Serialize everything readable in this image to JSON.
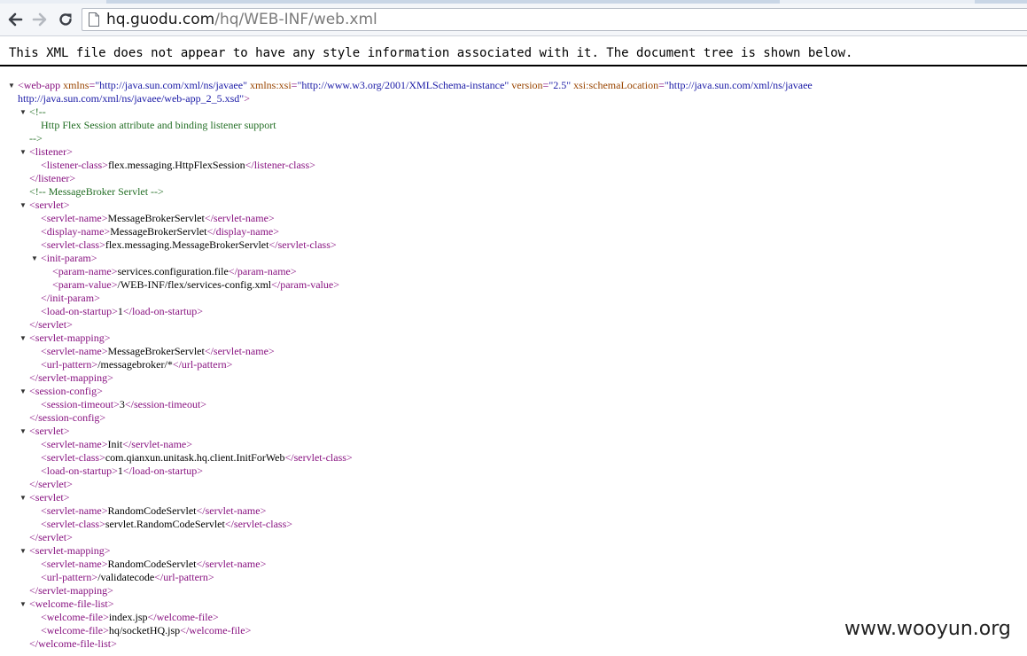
{
  "browser": {
    "url_host": "hq.guodu.com",
    "url_path": "/hq/WEB-INF/web.xml",
    "back_icon": "arrow-left-icon",
    "forward_icon": "arrow-right-icon",
    "reload_icon": "reload-icon",
    "page_icon": "page-icon"
  },
  "xml_viewer": {
    "header": "This XML file does not appear to have any style information associated with it. The document tree is shown below.",
    "colors": {
      "tag": "#881280",
      "attribute": "#994500",
      "value": "#1a1aa6",
      "comment": "#236e25"
    },
    "lines": [
      {
        "fold": true,
        "indent": 0,
        "parts": [
          [
            "tag",
            "<web-app "
          ],
          [
            "attr",
            "xmlns"
          ],
          [
            "tag",
            "="
          ],
          [
            "val",
            "\"http://java.sun.com/xml/ns/javaee\""
          ],
          [
            "tag",
            " "
          ],
          [
            "attr",
            "xmlns:xsi"
          ],
          [
            "tag",
            "="
          ],
          [
            "val",
            "\"http://www.w3.org/2001/XMLSchema-instance\""
          ],
          [
            "tag",
            " "
          ],
          [
            "attr",
            "version"
          ],
          [
            "tag",
            "="
          ],
          [
            "val",
            "\"2.5\""
          ],
          [
            "tag",
            " "
          ],
          [
            "attr",
            "xsi:schemaLocation"
          ],
          [
            "tag",
            "="
          ],
          [
            "val",
            "\"http://java.sun.com/xml/ns/javaee"
          ]
        ]
      },
      {
        "fold": false,
        "indent": 0,
        "parts": [
          [
            "val",
            "http://java.sun.com/xml/ns/javaee/web-app_2_5.xsd\""
          ],
          [
            "tag",
            ">"
          ]
        ]
      },
      {
        "fold": true,
        "indent": 1,
        "parts": [
          [
            "cmt",
            "<!--"
          ]
        ]
      },
      {
        "fold": false,
        "indent": 2,
        "parts": [
          [
            "cmt",
            "  Http Flex Session attribute and binding listener support"
          ]
        ]
      },
      {
        "fold": false,
        "indent": 1,
        "parts": [
          [
            "cmt",
            "-->"
          ]
        ]
      },
      {
        "fold": true,
        "indent": 1,
        "parts": [
          [
            "tag",
            "<listener>"
          ]
        ]
      },
      {
        "fold": false,
        "indent": 2,
        "parts": [
          [
            "tag",
            "<listener-class>"
          ],
          [
            "txt",
            "flex.messaging.HttpFlexSession"
          ],
          [
            "tag",
            "</listener-class>"
          ]
        ]
      },
      {
        "fold": false,
        "indent": 1,
        "parts": [
          [
            "tag",
            "</listener>"
          ]
        ]
      },
      {
        "fold": false,
        "indent": 1,
        "parts": [
          [
            "cmt",
            "<!--  MessageBroker Servlet  -->"
          ]
        ]
      },
      {
        "fold": true,
        "indent": 1,
        "parts": [
          [
            "tag",
            "<servlet>"
          ]
        ]
      },
      {
        "fold": false,
        "indent": 2,
        "parts": [
          [
            "tag",
            "<servlet-name>"
          ],
          [
            "txt",
            "MessageBrokerServlet"
          ],
          [
            "tag",
            "</servlet-name>"
          ]
        ]
      },
      {
        "fold": false,
        "indent": 2,
        "parts": [
          [
            "tag",
            "<display-name>"
          ],
          [
            "txt",
            "MessageBrokerServlet"
          ],
          [
            "tag",
            "</display-name>"
          ]
        ]
      },
      {
        "fold": false,
        "indent": 2,
        "parts": [
          [
            "tag",
            "<servlet-class>"
          ],
          [
            "txt",
            "flex.messaging.MessageBrokerServlet"
          ],
          [
            "tag",
            "</servlet-class>"
          ]
        ]
      },
      {
        "fold": true,
        "indent": 2,
        "parts": [
          [
            "tag",
            "<init-param>"
          ]
        ]
      },
      {
        "fold": false,
        "indent": 3,
        "parts": [
          [
            "tag",
            "<param-name>"
          ],
          [
            "txt",
            "services.configuration.file"
          ],
          [
            "tag",
            "</param-name>"
          ]
        ]
      },
      {
        "fold": false,
        "indent": 3,
        "parts": [
          [
            "tag",
            "<param-value>"
          ],
          [
            "txt",
            "/WEB-INF/flex/services-config.xml"
          ],
          [
            "tag",
            "</param-value>"
          ]
        ]
      },
      {
        "fold": false,
        "indent": 2,
        "parts": [
          [
            "tag",
            "</init-param>"
          ]
        ]
      },
      {
        "fold": false,
        "indent": 2,
        "parts": [
          [
            "tag",
            "<load-on-startup>"
          ],
          [
            "txt",
            "1"
          ],
          [
            "tag",
            "</load-on-startup>"
          ]
        ]
      },
      {
        "fold": false,
        "indent": 1,
        "parts": [
          [
            "tag",
            "</servlet>"
          ]
        ]
      },
      {
        "fold": true,
        "indent": 1,
        "parts": [
          [
            "tag",
            "<servlet-mapping>"
          ]
        ]
      },
      {
        "fold": false,
        "indent": 2,
        "parts": [
          [
            "tag",
            "<servlet-name>"
          ],
          [
            "txt",
            "MessageBrokerServlet"
          ],
          [
            "tag",
            "</servlet-name>"
          ]
        ]
      },
      {
        "fold": false,
        "indent": 2,
        "parts": [
          [
            "tag",
            "<url-pattern>"
          ],
          [
            "txt",
            "/messagebroker/*"
          ],
          [
            "tag",
            "</url-pattern>"
          ]
        ]
      },
      {
        "fold": false,
        "indent": 1,
        "parts": [
          [
            "tag",
            "</servlet-mapping>"
          ]
        ]
      },
      {
        "fold": true,
        "indent": 1,
        "parts": [
          [
            "tag",
            "<session-config>"
          ]
        ]
      },
      {
        "fold": false,
        "indent": 2,
        "parts": [
          [
            "tag",
            "<session-timeout>"
          ],
          [
            "txt",
            "3"
          ],
          [
            "tag",
            "</session-timeout>"
          ]
        ]
      },
      {
        "fold": false,
        "indent": 1,
        "parts": [
          [
            "tag",
            "</session-config>"
          ]
        ]
      },
      {
        "fold": true,
        "indent": 1,
        "parts": [
          [
            "tag",
            "<servlet>"
          ]
        ]
      },
      {
        "fold": false,
        "indent": 2,
        "parts": [
          [
            "tag",
            "<servlet-name>"
          ],
          [
            "txt",
            "Init"
          ],
          [
            "tag",
            "</servlet-name>"
          ]
        ]
      },
      {
        "fold": false,
        "indent": 2,
        "parts": [
          [
            "tag",
            "<servlet-class>"
          ],
          [
            "txt",
            "com.qianxun.unitask.hq.client.InitForWeb"
          ],
          [
            "tag",
            "</servlet-class>"
          ]
        ]
      },
      {
        "fold": false,
        "indent": 2,
        "parts": [
          [
            "tag",
            "<load-on-startup>"
          ],
          [
            "txt",
            "1"
          ],
          [
            "tag",
            "</load-on-startup>"
          ]
        ]
      },
      {
        "fold": false,
        "indent": 1,
        "parts": [
          [
            "tag",
            "</servlet>"
          ]
        ]
      },
      {
        "fold": true,
        "indent": 1,
        "parts": [
          [
            "tag",
            "<servlet>"
          ]
        ]
      },
      {
        "fold": false,
        "indent": 2,
        "parts": [
          [
            "tag",
            "<servlet-name>"
          ],
          [
            "txt",
            "RandomCodeServlet"
          ],
          [
            "tag",
            "</servlet-name>"
          ]
        ]
      },
      {
        "fold": false,
        "indent": 2,
        "parts": [
          [
            "tag",
            "<servlet-class>"
          ],
          [
            "txt",
            "servlet.RandomCodeServlet"
          ],
          [
            "tag",
            "</servlet-class>"
          ]
        ]
      },
      {
        "fold": false,
        "indent": 1,
        "parts": [
          [
            "tag",
            "</servlet>"
          ]
        ]
      },
      {
        "fold": true,
        "indent": 1,
        "parts": [
          [
            "tag",
            "<servlet-mapping>"
          ]
        ]
      },
      {
        "fold": false,
        "indent": 2,
        "parts": [
          [
            "tag",
            "<servlet-name>"
          ],
          [
            "txt",
            "RandomCodeServlet"
          ],
          [
            "tag",
            "</servlet-name>"
          ]
        ]
      },
      {
        "fold": false,
        "indent": 2,
        "parts": [
          [
            "tag",
            "<url-pattern>"
          ],
          [
            "txt",
            "/validatecode"
          ],
          [
            "tag",
            "</url-pattern>"
          ]
        ]
      },
      {
        "fold": false,
        "indent": 1,
        "parts": [
          [
            "tag",
            "</servlet-mapping>"
          ]
        ]
      },
      {
        "fold": true,
        "indent": 1,
        "parts": [
          [
            "tag",
            "<welcome-file-list>"
          ]
        ]
      },
      {
        "fold": false,
        "indent": 2,
        "parts": [
          [
            "tag",
            "<welcome-file>"
          ],
          [
            "txt",
            "index.jsp"
          ],
          [
            "tag",
            "</welcome-file>"
          ]
        ]
      },
      {
        "fold": false,
        "indent": 2,
        "parts": [
          [
            "tag",
            "<welcome-file>"
          ],
          [
            "txt",
            "hq/socketHQ.jsp"
          ],
          [
            "tag",
            "</welcome-file>"
          ]
        ]
      },
      {
        "fold": false,
        "indent": 1,
        "parts": [
          [
            "tag",
            "</welcome-file-list>"
          ]
        ]
      }
    ]
  },
  "watermark": "www.wooyun.org"
}
